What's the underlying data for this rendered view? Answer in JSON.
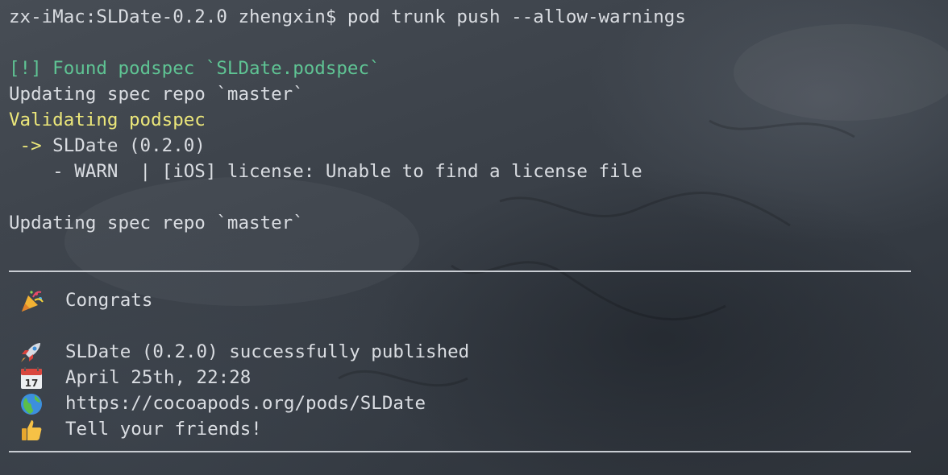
{
  "terminal": {
    "prompt": "zx-iMac:SLDate-0.2.0 zhengxin$ pod trunk push --allow-warnings",
    "found_podspec": "[!] Found podspec `SLDate.podspec`",
    "updating_1": "Updating spec repo `master`",
    "validating": "Validating podspec",
    "arrow": " ->",
    "pod_version": " SLDate (0.2.0)",
    "warn": "    - WARN  | [iOS] license: Unable to find a license file",
    "updating_2": "Updating spec repo `master`",
    "congrats": "Congrats",
    "published": "SLDate (0.2.0) successfully published",
    "date": "April 25th, 22:28",
    "url": "https://cocoapods.org/pods/SLDate",
    "tell": "Tell your friends!"
  },
  "icons": {
    "congrats": "party-popper-icon",
    "published": "rocket-icon",
    "date": "calendar-icon",
    "url": "globe-icon",
    "tell": "thumbs-up-icon"
  },
  "colors": {
    "green": "#5fc494",
    "yellow": "#ece77a",
    "text": "#dadde2"
  }
}
